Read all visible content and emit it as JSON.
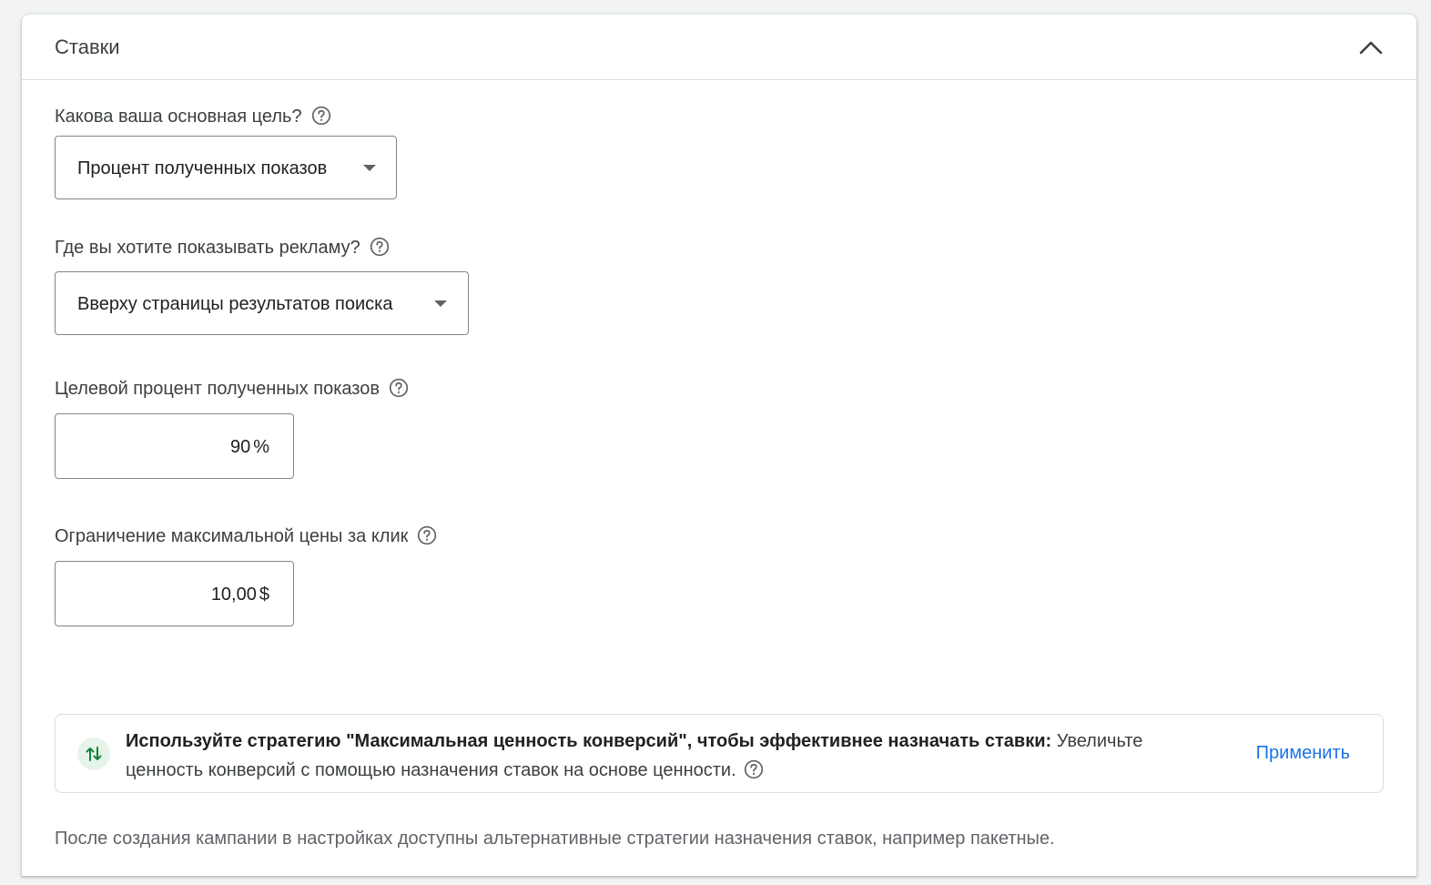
{
  "section": {
    "title": "Ставки"
  },
  "goal": {
    "label": "Какова ваша основная цель?",
    "selected": "Процент полученных показов"
  },
  "placement": {
    "label": "Где вы хотите показывать рекламу?",
    "selected": "Вверху страницы результатов поиска"
  },
  "target_share": {
    "label": "Целевой процент полученных показов",
    "value": "90",
    "suffix": "%"
  },
  "max_cpc": {
    "label": "Ограничение максимальной цены за клик",
    "value": "10,00",
    "suffix": "$"
  },
  "recommendation": {
    "bold_text": "Используйте стратегию \"Максимальная ценность конверсий\", чтобы эффективнее назначать ставки:",
    "text": "Увеличьте ценность конверсий с помощью назначения ставок на основе ценности.",
    "apply_label": "Применить",
    "icon": "swap-vert-icon"
  },
  "footer_note": "После создания кампании в настройках доступны альтернативные стратегии назначения ставок, например пакетные.",
  "colors": {
    "accent": "#1a73e8",
    "reco_icon_bg": "#e6f4ea",
    "reco_icon_fg": "#188038",
    "border": "#80868b"
  }
}
